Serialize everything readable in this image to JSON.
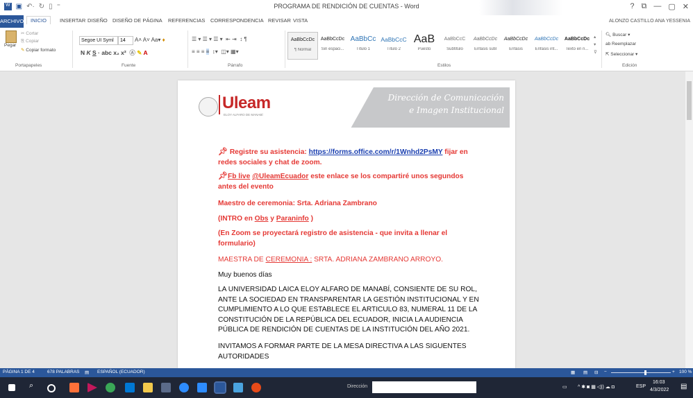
{
  "window": {
    "title": "PROGRAMA DE RENDICIÓN DE CUENTAS - Word",
    "user": "ALONZO CASTILLO ANA YESSENIA",
    "controls": [
      "?",
      "⧉",
      "—",
      "▢",
      "✕"
    ]
  },
  "tabs": [
    "ARCHIVO",
    "INICIO",
    "INSERTAR",
    "DISEÑO",
    "DISEÑO DE PÁGINA",
    "REFERENCIAS",
    "CORRESPONDENCIA",
    "REVISAR",
    "VISTA"
  ],
  "ribbon": {
    "clipboard": {
      "paste": "Pegar",
      "cut": "Cortar",
      "copy": "Copiar",
      "format_painter": "Copiar formato",
      "label": "Portapapeles"
    },
    "font": {
      "name": "Segoe UI Syml",
      "size": "14",
      "label": "Fuente"
    },
    "paragraph": {
      "label": "Párrafo"
    },
    "styles": {
      "label": "Estilos",
      "items": [
        {
          "preview": "AaBbCcDc",
          "name": "¶ Normal"
        },
        {
          "preview": "AaBbCcDc",
          "name": "Sin espaci..."
        },
        {
          "preview": "AaBbCc",
          "name": "Título 1"
        },
        {
          "preview": "AaBbCcC",
          "name": "Título 2"
        },
        {
          "preview": "AaB",
          "name": "Puesto"
        },
        {
          "preview": "AaBbCcC",
          "name": "Subtítulo"
        },
        {
          "preview": "AaBbCcDc",
          "name": "Énfasis sutil"
        },
        {
          "preview": "AaBbCcDc",
          "name": "Énfasis"
        },
        {
          "preview": "AaBbCcDc",
          "name": "Énfasis int..."
        },
        {
          "preview": "AaBbCcDc",
          "name": "Texto en n..."
        }
      ]
    },
    "editing": {
      "find": "Buscar",
      "replace": "Reemplazar",
      "select": "Seleccionar",
      "label": "Edición"
    }
  },
  "document": {
    "logo": "Uleam",
    "logo_sub": "ELOY ALFARO DE MANABÍ",
    "header_script_1": "Dirección de Comunicación",
    "header_script_2": "e Imagen Institucional",
    "p1_a": "Registre su asistencia: ",
    "p1_link": "https://forms.office.com/r/1Wnhd2PsMY",
    "p1_b": " fijar en redes sociales y chat de zoom.",
    "p2_fb": "Fb live",
    "p2_handle": "@UleamEcuador",
    "p2_b": " este enlace se los compartiré unos segundos antes del evento",
    "p3": "Maestro de ceremonia: Srta. Adriana Zambrano",
    "p4_a": "(INTRO  en ",
    "p4_obs": "Obs",
    "p4_y": " y ",
    "p4_para": "Paraninfo",
    "p4_end": " )",
    "p5": "(En Zoom se proyectará registro de asistencia -  que invita a llenar el formulario)",
    "p6_a": "MAESTRA DE ",
    "p6_cer": "CEREMONIA :",
    "p6_b": " SRTA. ADRIANA ZAMBRANO ARROYO.",
    "p7": "Muy buenos días",
    "p8": "LA UNIVERSIDAD LAICA ELOY ALFARO DE MANABÍ, CONSIENTE DE SU ROL, ANTE LA SOCIEDAD EN TRANSPARENTAR LA GESTIÓN INSTITUCIONAL Y EN CUMPLIMIENTO A LO QUE ESTABLECE EL ARTICULO 83, NUMERAL 11  DE LA CONSTITUCIÓN DE LA REPÚBLICA DEL ECUADOR,  INICIA LA AUDIENCIA PÚBLICA DE RENDICIÓN DE CUENTAS DE LA INSTITUCIÓN DEL AÑO 2021.",
    "p9": "INVITAMOS  A FORMAR PARTE DE LA MESA DIRECTIVA A LAS SIGUENTES AUTORIDADES"
  },
  "status": {
    "page": "PÁGINA 1 DE 4",
    "words": "678 PALABRAS",
    "language": "ESPAÑOL (ECUADOR)",
    "zoom": "100 %"
  },
  "taskbar": {
    "address_label": "Dirección",
    "lang": "ESP",
    "time": "16:03",
    "date": "4/3/2022"
  },
  "colors": {
    "word_blue": "#2b579a",
    "doc_red": "#e53935",
    "taskbar": "#1f2636"
  }
}
